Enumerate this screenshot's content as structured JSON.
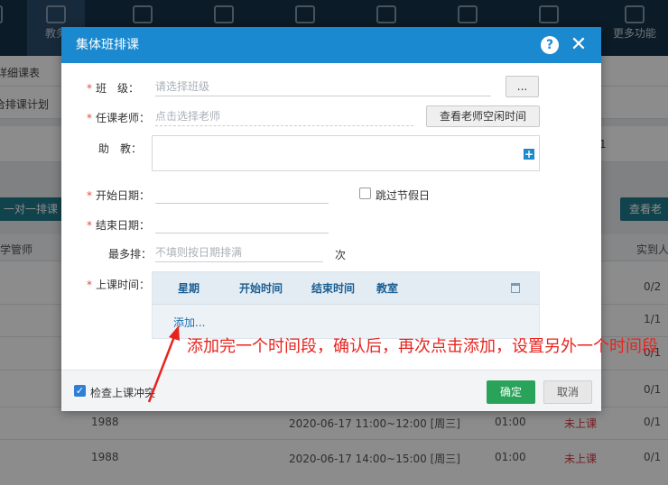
{
  "app": {
    "topnav": [
      {
        "label": "务",
        "icon": "clipboard-icon"
      },
      {
        "label": "教务",
        "icon": "book-icon"
      },
      {
        "label": "",
        "icon": "users-icon"
      },
      {
        "label": "",
        "icon": "edit-icon"
      },
      {
        "label": "",
        "icon": "screen-icon"
      },
      {
        "label": "",
        "icon": "message-icon"
      },
      {
        "label": "",
        "icon": "chart-icon"
      },
      {
        "label": "",
        "icon": "gear-icon"
      },
      {
        "label": "更多功能",
        "icon": "grid-icon"
      }
    ],
    "subtabs": {
      "detail": "详细课表",
      "plan": "合排课计划"
    },
    "buttons": {
      "one_on_one": "一对一排课",
      "view_teacher": "查看老"
    },
    "columns": {
      "teacher": "学管师",
      "attended": "实到人"
    },
    "page_num": "1",
    "rows": [
      {
        "value": "0/2"
      },
      {
        "value": "1/1"
      },
      {
        "value": "0/1"
      },
      {
        "value": "0/1"
      },
      {
        "name": "1988",
        "time": "2020-06-17 11:00~12:00 [周三]",
        "duration": "01:00",
        "status": "未上课",
        "value": "0/1"
      },
      {
        "name": "1988",
        "time": "2020-06-17 14:00~15:00 [周三]",
        "duration": "01:00",
        "status": "未上课",
        "value": "0/1"
      }
    ]
  },
  "modal": {
    "title": "集体班排课",
    "fields": {
      "class": {
        "label": "班　级：",
        "placeholder": "请选择班级",
        "btn": "..."
      },
      "teacher": {
        "label": "任课老师：",
        "placeholder": "点击选择老师",
        "btn": "查看老师空闲时间"
      },
      "assistant": {
        "label": "助　教："
      },
      "start_date": {
        "label": "开始日期：",
        "value": ""
      },
      "skip_holiday": {
        "label": "跳过节假日",
        "checked": false
      },
      "end_date": {
        "label": "结束日期：",
        "value": ""
      },
      "max_times": {
        "label": "最多排：",
        "placeholder": "不填则按日期排满",
        "unit": "次"
      },
      "class_time": {
        "label": "上课时间："
      }
    },
    "time_table": {
      "columns": [
        "星期",
        "开始时间",
        "结束时间",
        "教室"
      ],
      "add_link": "添加..."
    },
    "footer": {
      "conflict_check": {
        "label": "检查上课冲突",
        "checked": true
      },
      "ok": "确定",
      "cancel": "取消"
    }
  },
  "annotation": {
    "text": "添加完一个时间段，确认后，再次点击添加，设置另外一个时间段",
    "color": "#e8231e"
  }
}
